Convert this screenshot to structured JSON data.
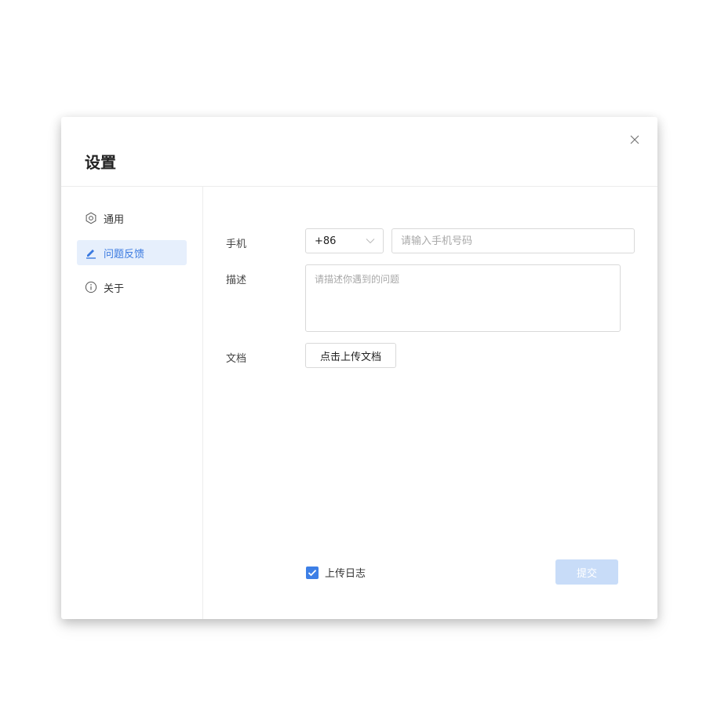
{
  "dialog": {
    "title": "设置"
  },
  "sidebar": {
    "items": [
      {
        "label": "通用",
        "icon": "gear-icon",
        "active": false
      },
      {
        "label": "问题反馈",
        "icon": "pencil-icon",
        "active": true
      },
      {
        "label": "关于",
        "icon": "info-icon",
        "active": false
      }
    ]
  },
  "form": {
    "phone": {
      "label": "手机",
      "country_code": "+86",
      "placeholder": "请输入手机号码",
      "value": ""
    },
    "description": {
      "label": "描述",
      "placeholder": "请描述你遇到的问题",
      "value": ""
    },
    "document": {
      "label": "文档",
      "upload_label": "点击上传文档"
    },
    "upload_log": {
      "label": "上传日志",
      "checked": true
    },
    "submit_label": "提交"
  },
  "colors": {
    "accent": "#3d7fe6",
    "active_bg": "#e6effc",
    "submit_disabled": "#c8dcf8",
    "border": "#d9d9d9"
  }
}
